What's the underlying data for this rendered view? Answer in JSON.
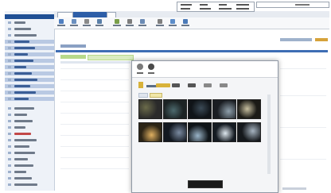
{
  "sidebar": {
    "head_color": "#1f4f95",
    "items": [
      {
        "kind": "plain",
        "icon": "folder-icon"
      },
      {
        "kind": "plain",
        "icon": "folder-icon"
      },
      {
        "kind": "plain",
        "icon": "folder-icon"
      },
      {
        "kind": "blue",
        "icon": "module-icon"
      },
      {
        "kind": "blue",
        "icon": "module-icon"
      },
      {
        "kind": "blue",
        "icon": "module-icon"
      },
      {
        "kind": "blue",
        "icon": "module-icon"
      },
      {
        "kind": "blue",
        "icon": "module-icon"
      },
      {
        "kind": "blue",
        "icon": "module-icon"
      },
      {
        "kind": "blue",
        "icon": "module-icon"
      },
      {
        "kind": "blue",
        "icon": "module-icon"
      },
      {
        "kind": "blue",
        "icon": "module-icon"
      },
      {
        "kind": "blue",
        "icon": "module-icon"
      },
      {
        "kind": "plain",
        "icon": "page-icon"
      },
      {
        "kind": "plain",
        "icon": "page-icon"
      },
      {
        "kind": "plain",
        "icon": "page-icon"
      },
      {
        "kind": "plain",
        "icon": "page-icon"
      },
      {
        "kind": "red",
        "icon": "page-icon"
      },
      {
        "kind": "plain",
        "icon": "page-icon"
      },
      {
        "kind": "plain",
        "icon": "page-icon"
      },
      {
        "kind": "plain",
        "icon": "page-icon"
      },
      {
        "kind": "plain",
        "icon": "page-icon"
      },
      {
        "kind": "plain",
        "icon": "page-icon"
      },
      {
        "kind": "plain",
        "icon": "page-icon"
      },
      {
        "kind": "plain",
        "icon": "page-icon"
      },
      {
        "kind": "plain",
        "icon": "page-icon"
      }
    ]
  },
  "ribbon": {
    "icons": [
      {
        "name": "new-icon",
        "color": "#4f7fc1"
      },
      {
        "name": "edit-icon",
        "color": "#6a8fbf"
      },
      {
        "name": "delete-icon",
        "color": "#8a8a8a"
      },
      {
        "name": "save-icon",
        "color": "#5a7fa8"
      },
      {
        "name": "publish-icon",
        "color": "#7a9f4a"
      },
      {
        "name": "link-icon",
        "color": "#7d7d7d"
      },
      {
        "name": "image-icon",
        "color": "#6b8bb5"
      },
      {
        "name": "settings-icon",
        "color": "#7f7f7f"
      },
      {
        "name": "preview-icon",
        "color": "#5b8cc9"
      },
      {
        "name": "help-icon",
        "color": "#4b7ab8"
      }
    ]
  },
  "colors": {
    "accent": "#3e6db4",
    "green_bar": "#b7d98a",
    "light_green_bar": "#d9ecc0",
    "dialog_bg": "#f4f5f7"
  },
  "dialog": {
    "tools": [
      {
        "name": "search-icon",
        "color": "#7a7a7a"
      },
      {
        "name": "upload-icon",
        "color": "#4a4a4a"
      }
    ],
    "toolbar_icons": [
      {
        "name": "folder-icon",
        "color": "#d8b23a"
      },
      {
        "name": "view-icon",
        "color": "#555"
      },
      {
        "name": "list-icon",
        "color": "#555"
      },
      {
        "name": "sort-icon",
        "color": "#888"
      },
      {
        "name": "delete-icon",
        "color": "#888"
      }
    ],
    "thumbnails": [
      {
        "tone": "#2a2a2a",
        "accent": "#6b6b4a"
      },
      {
        "tone": "#1c2324",
        "accent": "#4d6a6e"
      },
      {
        "tone": "#101418",
        "accent": "#3b4a56"
      },
      {
        "tone": "#1a1d22",
        "accent": "#8fa0ac"
      },
      {
        "tone": "#1b1a16",
        "accent": "#c8c0a0"
      },
      {
        "tone": "#2b2416",
        "accent": "#e0b060"
      },
      {
        "tone": "#121820",
        "accent": "#7a8aa0"
      },
      {
        "tone": "#0f1418",
        "accent": "#9ab4c8"
      },
      {
        "tone": "#151b22",
        "accent": "#dfe8ef"
      },
      {
        "tone": "#15181c",
        "accent": "#a6b3c0"
      }
    ]
  }
}
